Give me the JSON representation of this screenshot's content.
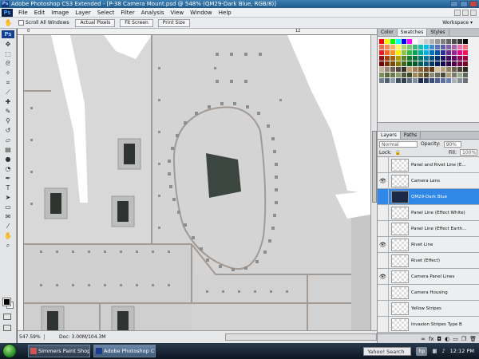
{
  "window": {
    "title": "Adobe Photoshop CS3 Extended - [P-38 Camera Mount.psd @ 548% (QM29-Dark Blue, RGB/8)]"
  },
  "menu": [
    "File",
    "Edit",
    "Image",
    "Layer",
    "Select",
    "Filter",
    "Analysis",
    "View",
    "Window",
    "Help"
  ],
  "options": {
    "scroll_all": "Scroll All Windows",
    "actual_pixels": "Actual Pixels",
    "fit_screen": "Fit Screen",
    "print_size": "Print Size",
    "workspace": "Workspace"
  },
  "tools": {
    "logo": "Ps",
    "icons": [
      "move-icon",
      "marquee-icon",
      "lasso-icon",
      "magic-wand-icon",
      "crop-icon",
      "slice-icon",
      "healing-icon",
      "brush-icon",
      "clone-stamp-icon",
      "history-brush-icon",
      "eraser-icon",
      "gradient-icon",
      "blur-icon",
      "dodge-icon",
      "pen-icon",
      "type-icon",
      "path-select-icon",
      "shape-icon",
      "notes-icon",
      "eyedropper-icon",
      "hand-icon",
      "zoom-icon"
    ]
  },
  "canvas": {
    "zoom": "547.59%",
    "doc": "Doc: 3.00M/104.3M",
    "ruler_marks": [
      "0",
      "12"
    ],
    "colors": {
      "panel_light": "#dcdcdc",
      "panel_mid": "#c4c4c4",
      "line": "#9a8e86",
      "rivet": "#8c8c8c",
      "lens": "#3c4640",
      "white": "#ffffff"
    }
  },
  "swatch_panel": {
    "tabs": [
      "Color",
      "Swatches",
      "Styles"
    ],
    "active_tab": "Swatches",
    "colors": [
      "#ff0000",
      "#ffff00",
      "#00ff00",
      "#00ffff",
      "#0000ff",
      "#ff00ff",
      "#ffffff",
      "#e6e6e6",
      "#cccccc",
      "#b3b3b3",
      "#999999",
      "#808080",
      "#666666",
      "#4d4d4d",
      "#333333",
      "#000000",
      "#f26c4f",
      "#f68e55",
      "#fbaf5c",
      "#fff467",
      "#acd372",
      "#7cc576",
      "#3bb878",
      "#1abbb4",
      "#00bff3",
      "#438ccb",
      "#5574b9",
      "#605ca8",
      "#855fa8",
      "#a763a8",
      "#f06ea9",
      "#f26d7d",
      "#ed1c24",
      "#f26522",
      "#f7941d",
      "#fff200",
      "#8dc63f",
      "#39b54a",
      "#00a651",
      "#00a99d",
      "#00aeef",
      "#0072bc",
      "#0054a6",
      "#2e3192",
      "#662d91",
      "#92278f",
      "#ec008c",
      "#ed145b",
      "#9e0b0f",
      "#a0410d",
      "#a36209",
      "#aba000",
      "#598527",
      "#1a7b30",
      "#007236",
      "#00746b",
      "#0076a3",
      "#004b80",
      "#003471",
      "#1b1464",
      "#440e62",
      "#630460",
      "#9e005d",
      "#9e0039",
      "#790000",
      "#7b2e00",
      "#7d4900",
      "#827b00",
      "#406618",
      "#005e20",
      "#005826",
      "#005952",
      "#005b7f",
      "#003663",
      "#002157",
      "#0d004c",
      "#32004b",
      "#4b0049",
      "#7b0046",
      "#7a0026",
      "#c7b299",
      "#998675",
      "#736357",
      "#534741",
      "#37302d",
      "#c69c6d",
      "#a67c52",
      "#8c6239",
      "#754c24",
      "#603913",
      "#d9c5a0",
      "#b8a37e",
      "#8f7e61",
      "#6b5e4a",
      "#4b4236",
      "#2e2921",
      "#7e8a5a",
      "#5c6b3c",
      "#6a7a4a",
      "#8a9a6a",
      "#4a5a3a",
      "#3a4a2a",
      "#9a8a5a",
      "#7a6a3a",
      "#5a4a2a",
      "#8a8a7a",
      "#6a6a5a",
      "#4a4a3a",
      "#aa9a7a",
      "#7a7a6a",
      "#9aaa8a",
      "#5a6a5a",
      "#6f7f8f",
      "#4f5f6f",
      "#8f9faf",
      "#3f4f5f",
      "#2f3f4f",
      "#5f6f7f",
      "#7f8f9f",
      "#1c2a48",
      "#2a3c60",
      "#3a4e78",
      "#4a6090",
      "#5a70a0",
      "#6a80b0",
      "#aab0b8",
      "#8a9098",
      "#6a7078"
    ]
  },
  "layers_panel": {
    "tabs": [
      "Layers",
      "Paths"
    ],
    "active_tab": "Layers",
    "blend_mode": "Normal",
    "opacity_label": "Opacity:",
    "opacity": "90%",
    "lock_label": "Lock:",
    "fill_label": "Fill:",
    "fill": "100%",
    "layers": [
      {
        "name": "Panel and Rivet Line (E...",
        "visible": false,
        "selected": false,
        "thumb": "checker"
      },
      {
        "name": "Camera Lens",
        "visible": true,
        "selected": false,
        "thumb": "checker"
      },
      {
        "name": "QM29-Dark Blue",
        "visible": false,
        "selected": true,
        "thumb": "dark"
      },
      {
        "name": "Panel Line (Effect White)",
        "visible": false,
        "selected": false,
        "thumb": "checker"
      },
      {
        "name": "Panel Line (Effect Earth...",
        "visible": false,
        "selected": false,
        "thumb": "checker"
      },
      {
        "name": "Rivet Line",
        "visible": true,
        "selected": false,
        "thumb": "checker"
      },
      {
        "name": "Rivet (Effect)",
        "visible": false,
        "selected": false,
        "thumb": "checker"
      },
      {
        "name": "Camera Panel Lines",
        "visible": true,
        "selected": false,
        "thumb": "checker"
      },
      {
        "name": "Camera Housing",
        "visible": false,
        "selected": false,
        "thumb": "checker"
      },
      {
        "name": "Yellow Stripes",
        "visible": false,
        "selected": false,
        "thumb": "checker"
      },
      {
        "name": "Invasion Stripes Type B",
        "visible": false,
        "selected": false,
        "thumb": "checker"
      }
    ]
  },
  "taskbar": {
    "items": [
      {
        "label": "Simmers Paint Shop...",
        "active": false
      },
      {
        "label": "Adobe Photoshop C...",
        "active": true
      }
    ],
    "search_placeholder": "Yahoo! Search",
    "hp_label": "hp",
    "time": "12:12 PM"
  }
}
